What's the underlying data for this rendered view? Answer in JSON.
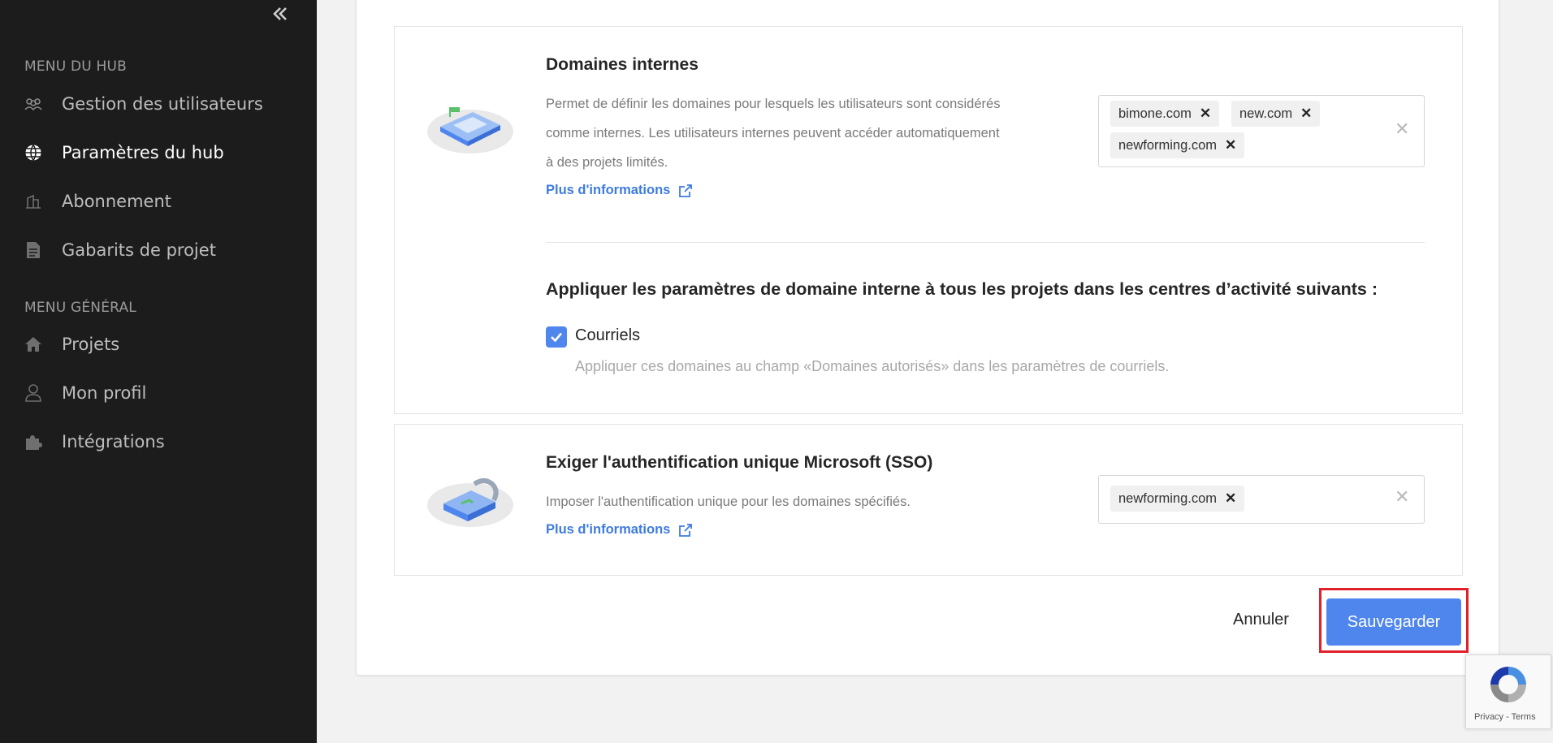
{
  "sidebar": {
    "collapse_icon": "double-chevron-left-icon",
    "hub_menu_label": "MENU DU HUB",
    "hub_items": [
      {
        "label": "Gestion des utilisateurs",
        "icon": "users-icon"
      },
      {
        "label": "Paramètres du hub",
        "icon": "globe-icon",
        "active": true
      },
      {
        "label": "Abonnement",
        "icon": "building-icon"
      },
      {
        "label": "Gabarits de projet",
        "icon": "document-icon"
      }
    ],
    "general_menu_label": "MENU GÉNÉRAL",
    "general_items": [
      {
        "label": "Projets",
        "icon": "home-icon"
      },
      {
        "label": "Mon profil",
        "icon": "user-icon"
      },
      {
        "label": "Intégrations",
        "icon": "puzzle-icon"
      }
    ]
  },
  "internal_domains": {
    "title": "Domaines internes",
    "description_lines": [
      "Permet de définir les domaines pour lesquels les utilisateurs sont considérés",
      "comme internes. Les utilisateurs internes peuvent accéder automatiquement",
      "à des projets limités."
    ],
    "more_info": "Plus d'informations",
    "tags": [
      "bimone.com",
      "new.com",
      "newforming.com"
    ],
    "tag_remove": "✕",
    "clear": "✕"
  },
  "apply_settings": {
    "title": "Appliquer les paramètres de domaine interne à tous les projets dans les centres d’activité suivants :",
    "checkbox_label": "Courriels",
    "checkbox_checked": true,
    "help": "Appliquer ces domaines au champ «Domaines autorisés» dans les paramètres de courriels."
  },
  "sso": {
    "title": "Exiger l'authentification unique Microsoft (SSO)",
    "description": "Imposer l'authentification unique pour les domaines spécifiés.",
    "more_info": "Plus d'informations",
    "tags": [
      "newforming.com"
    ],
    "tag_remove": "✕",
    "clear": "✕"
  },
  "actions": {
    "cancel": "Annuler",
    "save": "Sauvegarder"
  },
  "recaptcha": {
    "terms": "Privacy - Terms"
  },
  "colors": {
    "sidebar_bg": "#1c1c1c",
    "accent": "#4f86ee",
    "link": "#3d7be0",
    "highlight": "#e0202a"
  }
}
